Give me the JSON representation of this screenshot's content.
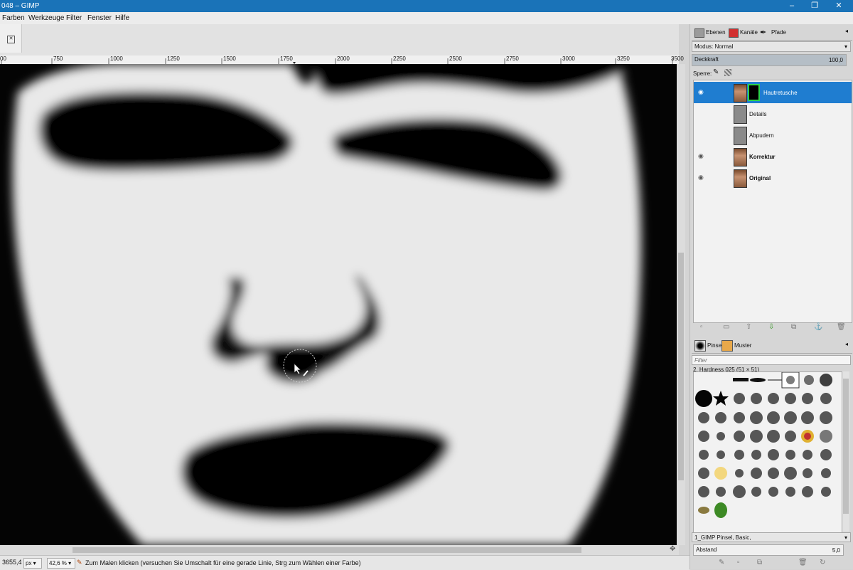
{
  "window": {
    "title": "048 – GIMP",
    "buttons": {
      "minimize": "–",
      "maximize": "❐",
      "close": "✕"
    }
  },
  "menu": [
    "Farben",
    "Werkzeuge",
    "Filter",
    "Fenster",
    "Hilfe"
  ],
  "ruler": {
    "labels": [
      "00",
      "750",
      "1000",
      "1250",
      "1500",
      "1750",
      "2000",
      "2250",
      "2500",
      "2750",
      "3000",
      "3250",
      "3500"
    ]
  },
  "status": {
    "coords": "3655,4",
    "unit": "px",
    "zoom": "42,6 %",
    "message": "Zum Malen klicken (versuchen Sie Umschalt für eine gerade Linie, Strg zum Wählen einer Farbe)"
  },
  "dock": {
    "tabs": [
      "Ebenen",
      "Kanäle",
      "Pfade"
    ],
    "mode_label": "Modus: Normal",
    "opacity_label": "Deckkraft",
    "opacity_value": "100,0",
    "lock_label": "Sperre:",
    "layers": [
      {
        "name": "Hautretusche",
        "visible": true,
        "selected": true,
        "bold": false
      },
      {
        "name": "Details",
        "visible": false,
        "selected": false,
        "bold": false
      },
      {
        "name": "Abpudern",
        "visible": false,
        "selected": false,
        "bold": false
      },
      {
        "name": "Korrektur",
        "visible": true,
        "selected": false,
        "bold": true
      },
      {
        "name": "Original",
        "visible": true,
        "selected": false,
        "bold": true
      }
    ],
    "brush_tabs": [
      "Pinsel",
      "Muster"
    ],
    "filter_placeholder": "Filter",
    "brush_name": "2. Hardness 025 (51 × 51)",
    "brush_tag": "1_GIMP Pinsel, Basic,",
    "spacing_label": "Abstand",
    "spacing_value": "5,0"
  },
  "colors": {
    "titlebar": "#1a73b8",
    "selection": "#1f7dd0",
    "mask_border": "#2bd24a"
  }
}
